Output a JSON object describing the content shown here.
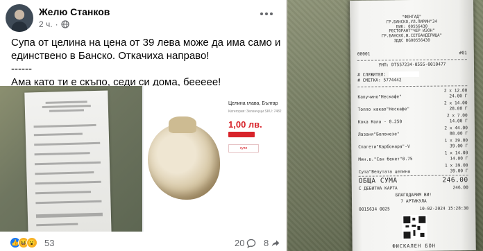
{
  "post": {
    "author": "Желю Станков",
    "time": "2 ч.",
    "text_lines": [
      "Супа от целина на цена от 39 лева може да има само и единствено в Банско. Откачиха направо!",
      "------",
      "Ама като ти е скъпо, седи си дома, беееее!"
    ],
    "media": {
      "product_title": "Целина глава, Българ",
      "product_sub": "Категория: Зеленчуци   SKU: 7482",
      "product_price": "1,00 лв.",
      "product_button": "купи"
    },
    "reactions": {
      "icons": [
        "like-icon",
        "haha-icon",
        "wow-icon"
      ],
      "count": "53"
    },
    "comments_count": "20",
    "shares_count": "8"
  },
  "receipt": {
    "header_lines": [
      "\"ФЕНГАД\"",
      "ГР.БАНСКО,УЛ.ПИРИН\"34",
      "ЕИК: 00556430",
      "РЕСТОРАНТ\"ЧЕР ИЗОН\"",
      "ГР.БАНСКО,Ж.СЕТБАНДЕРИЦА\"",
      "ЗДДС BG00556430"
    ],
    "register_no": "00001",
    "register_code": "#01",
    "unp": "УНП: DT557234-0555-0010477",
    "waiter_label": "# СЛУЖИТЕЛ:",
    "account_label": "# СМЕТКА:",
    "account_no": "5774442",
    "items": [
      {
        "qty_line": "2 x 12.00",
        "name": "Капучино\"Нескафе\"",
        "amount": "24.00 Г"
      },
      {
        "qty_line": "2 x 14.00",
        "name": "Топло какао\"Нескафе\"",
        "amount": "28.00 Г"
      },
      {
        "qty_line": "2 x 7.00",
        "name": "Кока Кола - 0.250",
        "amount": "14.00 Г"
      },
      {
        "qty_line": "2 x 44.00",
        "name": "Лазаня\"Болонезе\"",
        "amount": "88.00 Г"
      },
      {
        "qty_line": "1 x 39.00",
        "name": "Спагети\"Карбонара\"-V",
        "amount": "39.00 Г"
      },
      {
        "qty_line": "1 x 14.00",
        "name": "Мин.в.\"Сан бенет\"0.75",
        "amount": "14.00 Г"
      },
      {
        "qty_line": "1 x 39.00",
        "name": "Супа\"Велутата целина",
        "amount": "39.00 Г"
      }
    ],
    "total_label": "ОБЩА СУМА",
    "total_value": "246.00",
    "payment": "С ДЕБИТНА КАРТА",
    "payment_value": "246.00",
    "thanks": "БЛАГОДАРИМ ВИ!",
    "articles": "7 АРТИКУЛА",
    "fiscal_no": "0015634 0025",
    "datetime": "10-02-2024 15:28:30",
    "fiscal_label": "ФИСКАЛЕН БОН"
  }
}
